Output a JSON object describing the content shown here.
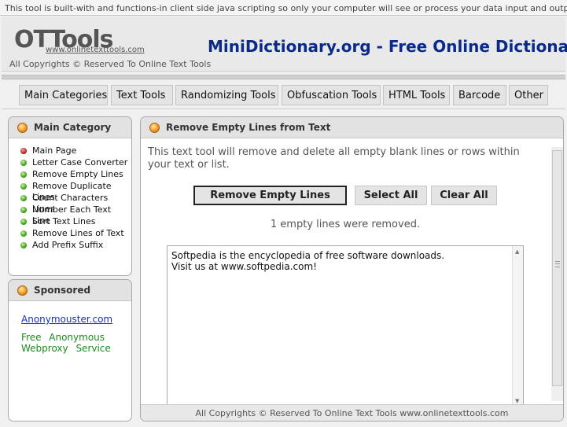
{
  "notice": "This tool is built-with and functions-in client side java scripting so only your computer will see or process your data input and output.",
  "header": {
    "logo": "OTTools",
    "logo_url": "www.onlinetexttools.com",
    "copyright": "All Copyrights © Reserved To Online Text Tools",
    "site_title": "MiniDictionary.org - Free Online Dictionary"
  },
  "nav": {
    "items": [
      "Main Categories",
      "Text Tools",
      "Randomizing Tools",
      "Obfuscation Tools",
      "HTML Tools",
      "Barcode",
      "Other"
    ]
  },
  "sidebar": {
    "category_title": "Main Category",
    "items": [
      {
        "label": "Main Page",
        "status": "red"
      },
      {
        "label": "Letter Case Converter",
        "status": "green"
      },
      {
        "label": "Remove Empty Lines",
        "status": "green"
      },
      {
        "label": "Remove Duplicate Lines",
        "status": "green"
      },
      {
        "label": "Count Characters Lines",
        "status": "green"
      },
      {
        "label": "Number Each Text Line",
        "status": "green"
      },
      {
        "label": "Sort Text Lines",
        "status": "green"
      },
      {
        "label": "Remove Lines of Text",
        "status": "green"
      },
      {
        "label": "Add Prefix Suffix",
        "status": "green"
      }
    ],
    "sponsored_title": "Sponsored",
    "sponsor_link": "Anonymouster.com",
    "sponsor_text": "Free Anonymous Webproxy Service"
  },
  "main": {
    "title": "Remove Empty Lines from Text",
    "description": "This text tool will remove and delete all empty blank lines or rows within your text or list.",
    "buttons": {
      "remove": "Remove Empty Lines",
      "select_all": "Select All",
      "clear_all": "Clear All"
    },
    "status": "1 empty lines were removed.",
    "text_lines": [
      "Softpedia is the encyclopedia of free software downloads.",
      "Visit us at www.softpedia.com!"
    ],
    "footer": "All Copyrights © Reserved To Online Text Tools  www.onlinetexttools.com"
  },
  "icons": {
    "panel_orb": "orange-orb-icon",
    "item_bullet": "green-dot-icon",
    "scroll_up": "scroll-up-arrow-icon",
    "scroll_down": "scroll-down-arrow-icon"
  },
  "colors": {
    "site_title": "#0a2a8a",
    "link": "#1a2fbf",
    "sponsor_text": "#1f8a1f",
    "orb": "#f29a1e",
    "bullet_green": "#3fa318",
    "bullet_red": "#c02020"
  }
}
